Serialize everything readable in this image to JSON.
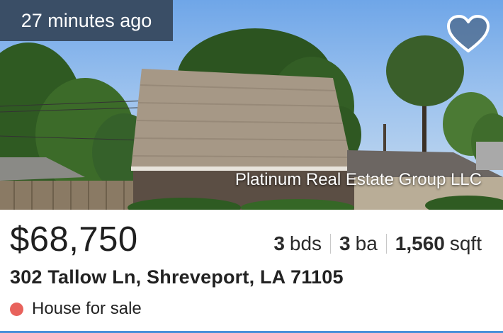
{
  "listing": {
    "time_badge": "27 minutes ago",
    "favorite_icon": "heart-icon",
    "photo_credit": "Platinum Real Estate Group LLC",
    "price": "$68,750",
    "beds_value": "3",
    "beds_unit": "bds",
    "baths_value": "3",
    "baths_unit": "ba",
    "sqft_value": "1,560",
    "sqft_unit": "sqft",
    "address": "302 Tallow Ln, Shreveport, LA 71105",
    "status": "House for sale",
    "status_color": "#e8625c",
    "badge_color": "#3a4e66",
    "accent_color": "#4a90d9"
  }
}
